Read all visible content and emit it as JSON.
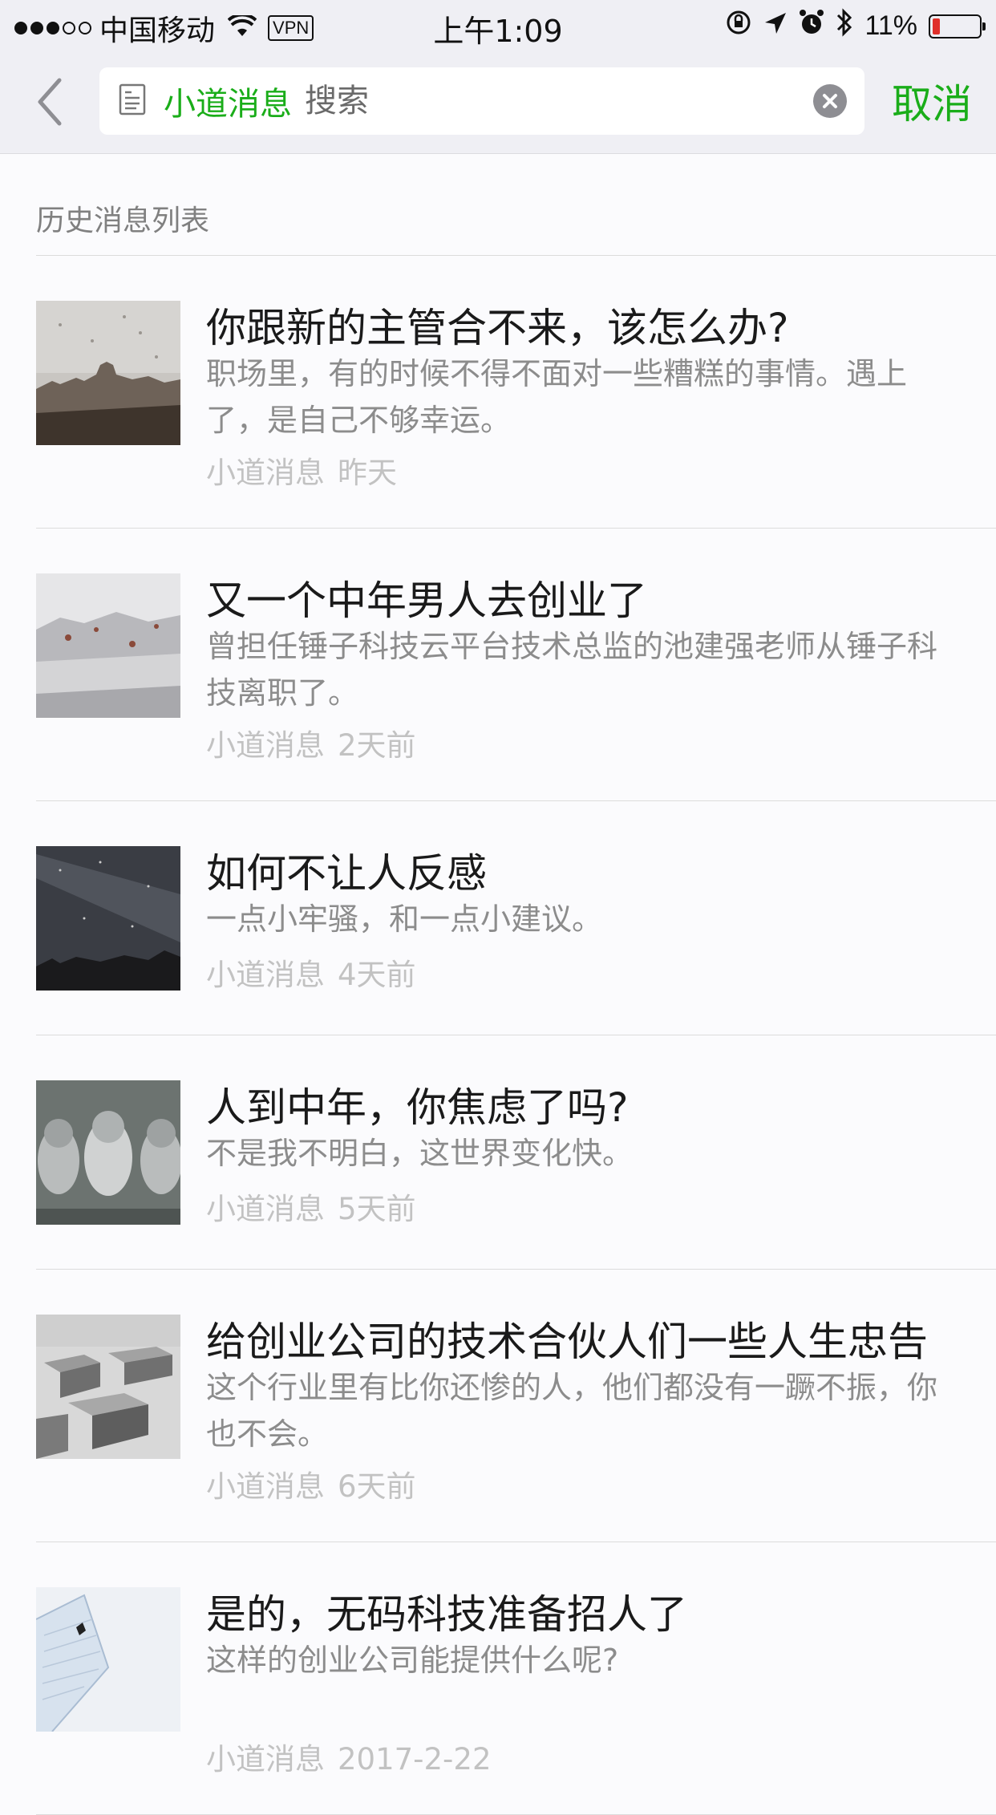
{
  "status_bar": {
    "carrier": "中国移动",
    "vpn": "VPN",
    "time": "上午1:09",
    "battery": "11%",
    "battery_level": 0.11
  },
  "nav": {
    "scope_label": "小道消息",
    "search_placeholder": "搜索",
    "cancel_label": "取消"
  },
  "section_header": "历史消息列表",
  "articles": [
    {
      "title": "你跟新的主管合不来，该怎么办?",
      "digest": "职场里，有的时候不得不面对一些糟糕的事情。遇上了，是自己不够幸运。",
      "source": "小道消息",
      "date": "昨天"
    },
    {
      "title": "又一个中年男人去创业了",
      "digest": "曾担任锤子科技云平台技术总监的池建强老师从锤子科技离职了。",
      "source": "小道消息",
      "date": "2天前"
    },
    {
      "title": "如何不让人反感",
      "digest": "一点小牢骚，和一点小建议。",
      "source": "小道消息",
      "date": "4天前"
    },
    {
      "title": "人到中年，你焦虑了吗?",
      "digest": "不是我不明白，这世界变化快。",
      "source": "小道消息",
      "date": "5天前"
    },
    {
      "title": "给创业公司的技术合伙人们一些人生忠告",
      "digest": "这个行业里有比你还惨的人，他们都没有一蹶不振，你也不会。",
      "source": "小道消息",
      "date": "6天前"
    },
    {
      "title": "是的，无码科技准备招人了",
      "digest": "这样的创业公司能提供什么呢?",
      "source": "小道消息",
      "date": "2017-2-22"
    }
  ],
  "colors": {
    "accent_green": "#1aad19",
    "nav_background": "#efeff4",
    "meta_gray": "#c2c2c2"
  }
}
